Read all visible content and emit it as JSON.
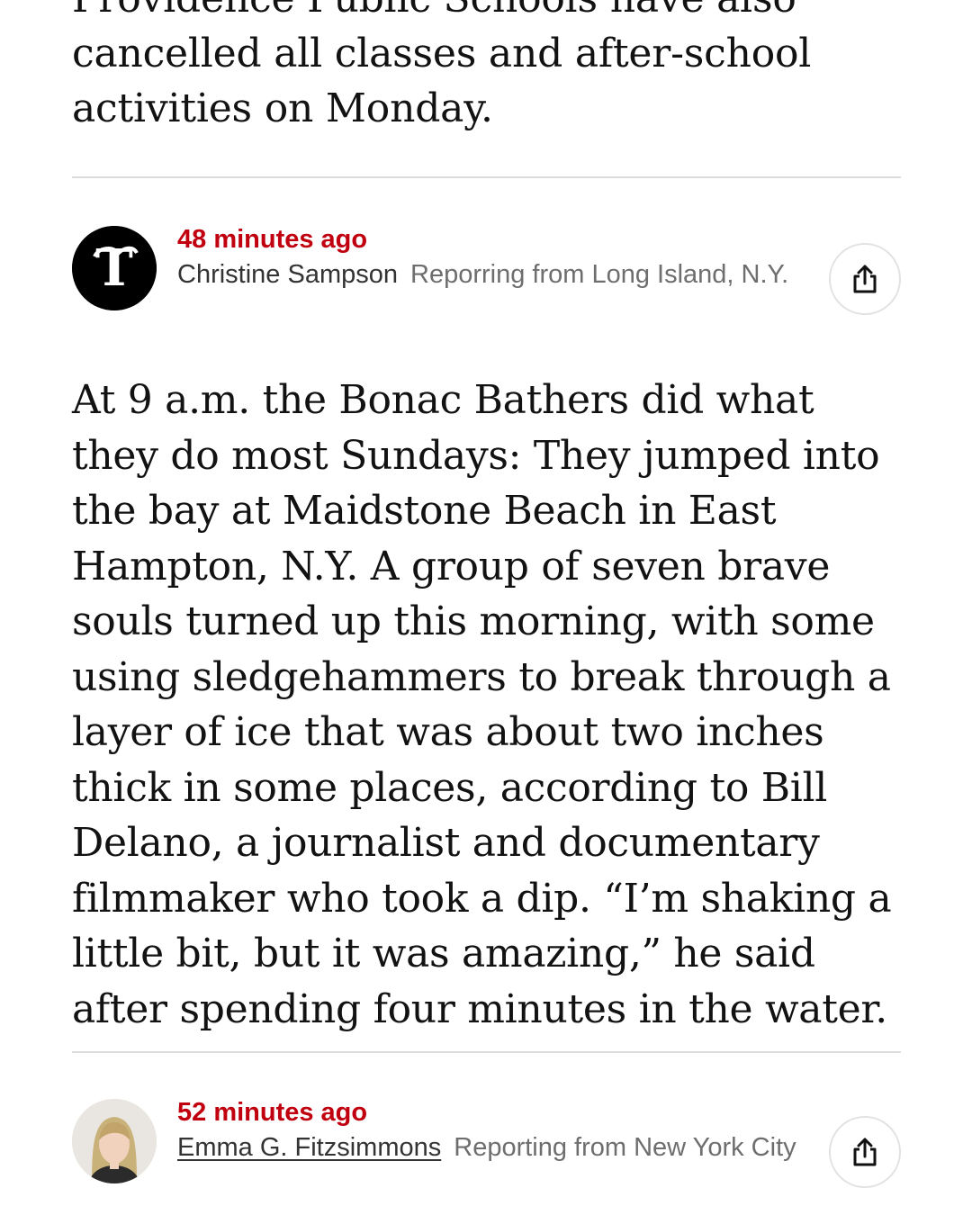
{
  "previous_post": {
    "text": "Providence Public Schools have also cancelled all classes and after-school activities on Monday."
  },
  "posts": [
    {
      "timestamp": "48 minutes ago",
      "author": "Christine Sampson",
      "location": "Reporring from Long Island, N.Y.",
      "avatar_icon": "nyt-logo-icon",
      "body": "At 9 a.m. the Bonac Bathers did what they do most Sundays: They jumped into the bay at Maidstone Beach in East Hampton, N.Y. A group of seven brave souls turned up this morning, with some using sledgehammers to break through a layer of ice that was about two inches thick in some places, according to Bill Delano, a journalist and documentary filmmaker who took a dip. “I’m shaking a little bit, but it was amazing,” he said after spending four minutes in the water."
    },
    {
      "timestamp": "52 minutes ago",
      "author": "Emma G. Fitzsimmons",
      "location": "Reporting from New York City",
      "avatar_icon": "author-photo"
    }
  ],
  "icons": {
    "share": "share-icon"
  },
  "colors": {
    "timestamp_red": "#c1000f",
    "divider": "#dcdcdc",
    "location_gray": "#6e6e6e"
  }
}
